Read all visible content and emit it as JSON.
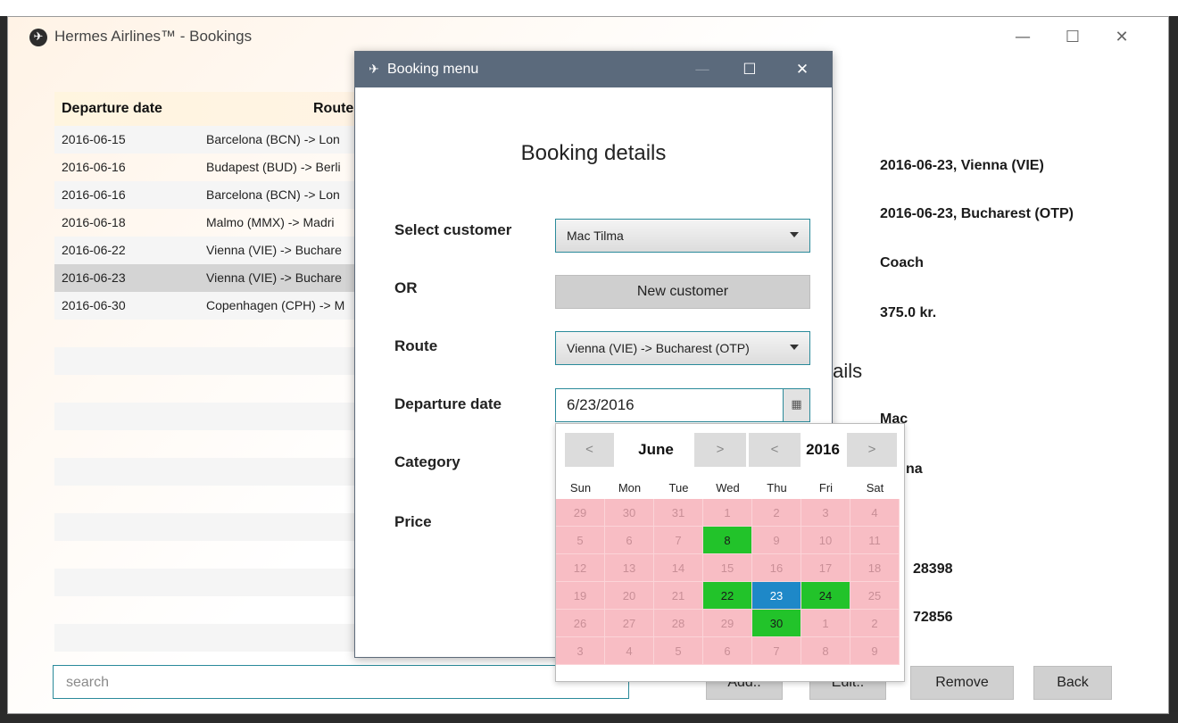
{
  "main_window": {
    "title": "Hermes Airlines™  -  Bookings",
    "minimize": "—",
    "maximize": "☐",
    "close": "✕"
  },
  "table": {
    "headers": [
      "Departure date",
      "Route"
    ],
    "rows": [
      {
        "date": "2016-06-15",
        "route": "Barcelona (BCN) -> Lon"
      },
      {
        "date": "2016-06-16",
        "route": "Budapest (BUD) -> Berli"
      },
      {
        "date": "2016-06-16",
        "route": "Barcelona (BCN) -> Lon"
      },
      {
        "date": "2016-06-18",
        "route": "Malmo (MMX) -> Madri"
      },
      {
        "date": "2016-06-22",
        "route": "Vienna (VIE) -> Buchare"
      },
      {
        "date": "2016-06-23",
        "route": "Vienna (VIE) -> Buchare"
      },
      {
        "date": "2016-06-30",
        "route": "Copenhagen (CPH) -> M"
      }
    ],
    "selected_index": 5
  },
  "search": {
    "placeholder": "search"
  },
  "details": {
    "departure": "2016-06-23, Vienna (VIE)",
    "arrival": "2016-06-23, Bucharest (OTP)",
    "category": "Coach",
    "price": "375.0 kr.",
    "customer_section_partial": "tails",
    "first_name_partial": "Mac",
    "last_name_partial": "na",
    "phone_partial": "28398",
    "other_partial": "72856"
  },
  "actions": {
    "add": "Add..",
    "edit": "Edit..",
    "remove": "Remove",
    "back": "Back"
  },
  "dialog": {
    "title": "Booking menu",
    "minimize": "—",
    "maximize": "☐",
    "close": "✕",
    "heading": "Booking details",
    "labels": {
      "select_customer": "Select customer",
      "or": "OR",
      "route": "Route",
      "departure_date": "Departure date",
      "category": "Category",
      "price": "Price"
    },
    "customer_value": "Mac Tilma",
    "new_customer": "New customer",
    "route_value": "Vienna (VIE) -> Bucharest (OTP)",
    "date_value": "6/23/2016"
  },
  "calendar": {
    "month": "June",
    "year": "2016",
    "prev": "<",
    "next": ">",
    "weekdays": [
      "Sun",
      "Mon",
      "Tue",
      "Wed",
      "Thu",
      "Fri",
      "Sat"
    ],
    "days": [
      [
        "29",
        "30",
        "31",
        "1",
        "2",
        "3",
        "4"
      ],
      [
        "5",
        "6",
        "7",
        "8",
        "9",
        "10",
        "11"
      ],
      [
        "12",
        "13",
        "14",
        "15",
        "16",
        "17",
        "18"
      ],
      [
        "19",
        "20",
        "21",
        "22",
        "23",
        "24",
        "25"
      ],
      [
        "26",
        "27",
        "28",
        "29",
        "30",
        "1",
        "2"
      ],
      [
        "3",
        "4",
        "5",
        "6",
        "7",
        "8",
        "9"
      ]
    ],
    "available_days": [
      "8",
      "22",
      "24",
      "30"
    ],
    "selected_day": "23",
    "colors": {
      "available": "#22c32a",
      "selected": "#1e88c8",
      "unavailable": "#f8bdc4"
    }
  }
}
